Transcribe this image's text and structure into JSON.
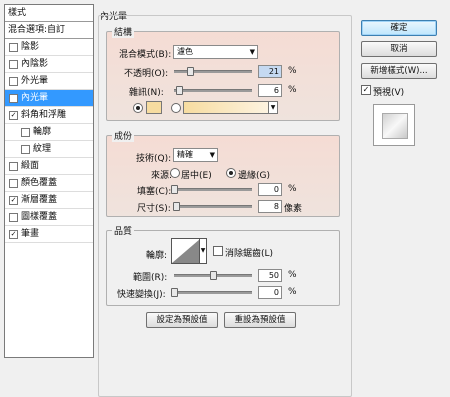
{
  "style_list": {
    "header": "樣式",
    "blending": "混合選項:自訂",
    "items": [
      {
        "label": "陰影",
        "checked": false,
        "selected": false,
        "sub": false
      },
      {
        "label": "內陰影",
        "checked": false,
        "selected": false,
        "sub": false
      },
      {
        "label": "外光暈",
        "checked": false,
        "selected": false,
        "sub": false
      },
      {
        "label": "內光暈",
        "checked": true,
        "selected": true,
        "sub": false
      },
      {
        "label": "斜角和浮雕",
        "checked": true,
        "selected": false,
        "sub": false
      },
      {
        "label": "輪廓",
        "checked": false,
        "selected": false,
        "sub": true
      },
      {
        "label": "紋理",
        "checked": false,
        "selected": false,
        "sub": true
      },
      {
        "label": "緞面",
        "checked": false,
        "selected": false,
        "sub": false
      },
      {
        "label": "顏色覆蓋",
        "checked": false,
        "selected": false,
        "sub": false
      },
      {
        "label": "漸層覆蓋",
        "checked": true,
        "selected": false,
        "sub": false
      },
      {
        "label": "圖樣覆蓋",
        "checked": false,
        "selected": false,
        "sub": false
      },
      {
        "label": "筆畫",
        "checked": true,
        "selected": false,
        "sub": false
      }
    ]
  },
  "panel_title": "內光暈",
  "structure": {
    "title": "結構",
    "blend_mode_label": "混合模式(B):",
    "blend_mode_value": "濾色",
    "opacity_label": "不透明(O):",
    "opacity_value": "21",
    "opacity_unit": "%",
    "noise_label": "雜訊(N):",
    "noise_value": "6",
    "noise_unit": "%",
    "opacity_fraction": 0.21,
    "noise_fraction": 0.06
  },
  "elements": {
    "title": "成份",
    "technique_label": "技術(Q):",
    "technique_value": "精確",
    "source_label": "來源:",
    "source_center": "居中(E)",
    "source_edge": "邊緣(G)",
    "choke_label": "填塞(C):",
    "choke_value": "0",
    "choke_unit": "%",
    "size_label": "尺寸(S):",
    "size_value": "8",
    "size_unit": "像素",
    "choke_fraction": 0.0,
    "size_fraction": 0.03
  },
  "quality": {
    "title": "品質",
    "contour_label": "輪廓:",
    "anti_alias_label": "消除鋸齒(L)",
    "range_label": "範圍(R):",
    "range_value": "50",
    "range_unit": "%",
    "jitter_label": "快速變換(J):",
    "jitter_value": "0",
    "jitter_unit": "%",
    "range_fraction": 0.5,
    "jitter_fraction": 0.0
  },
  "buttons": {
    "make_default": "設定為預設值",
    "reset_default": "重設為預設值",
    "ok": "確定",
    "cancel": "取消",
    "new_style": "新增樣式(W)...",
    "preview": "預視(V)"
  },
  "colors": {
    "glow_color": "#f7dca0",
    "accent": "#3399ff"
  }
}
